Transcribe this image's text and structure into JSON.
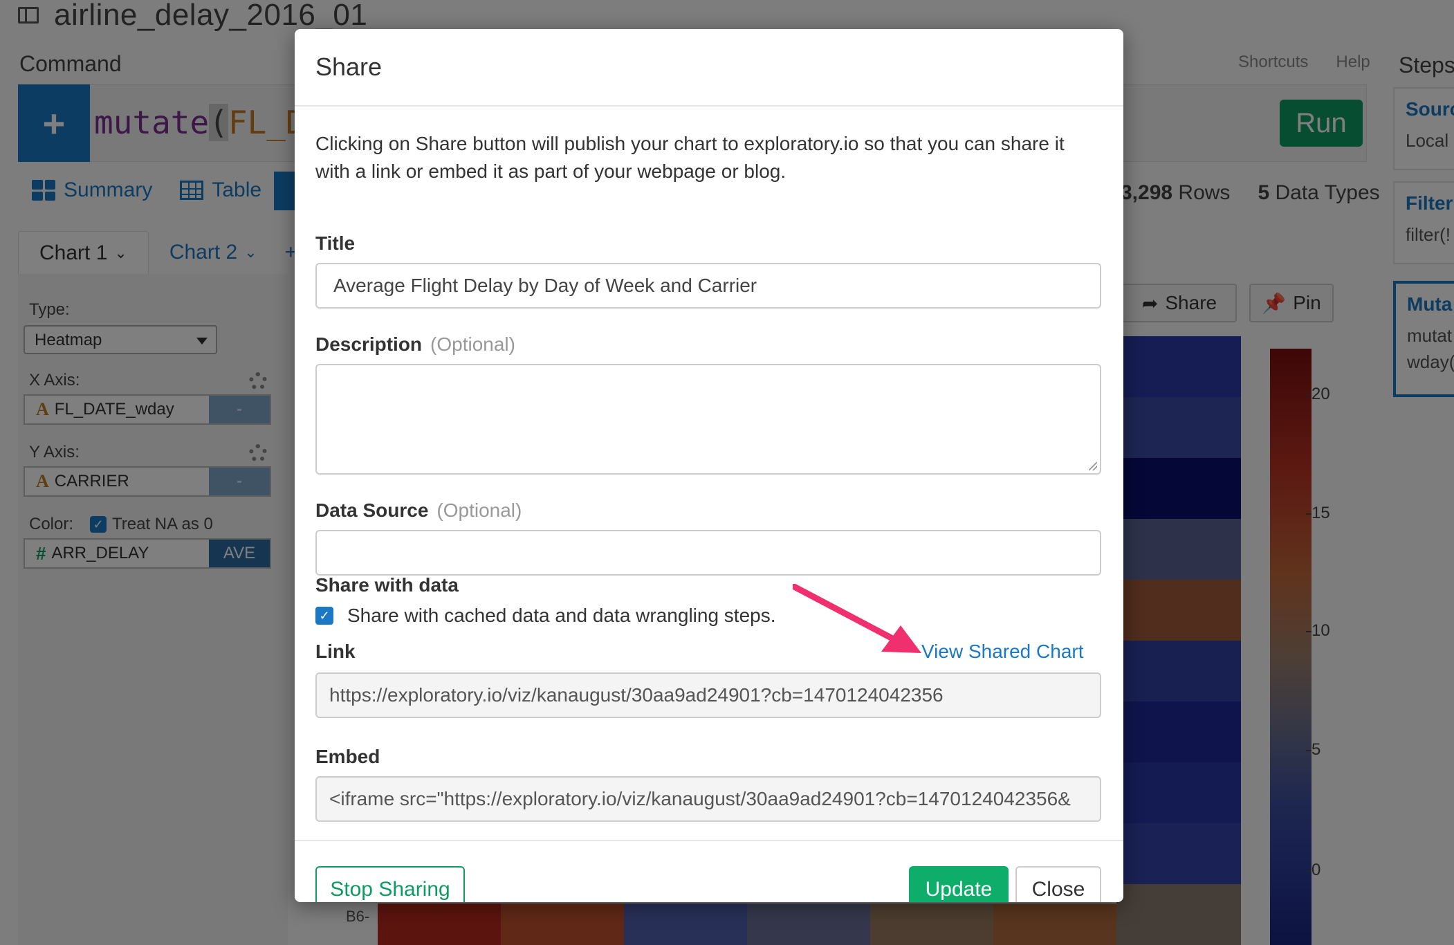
{
  "app": {
    "title": "airline_delay_2016_01",
    "command_label": "Command",
    "shortcuts": "Shortcuts",
    "help": "Help",
    "steps_label": "Steps",
    "command_text": {
      "fn": "mutate",
      "open": "(",
      "arg": "FL_DA"
    },
    "run_label": "Run",
    "view_tabs": [
      "Summary",
      "Table"
    ],
    "stats": {
      "rows_count": "3,298",
      "rows_label": "Rows",
      "types_count": "5",
      "types_label": "Data Types"
    },
    "chart_tabs": [
      "Chart 1",
      "Chart 2"
    ],
    "chart_add": "+",
    "config": {
      "type_label": "Type:",
      "type_value": "Heatmap",
      "x_label": "X Axis:",
      "x_value": "FL_DATE_wday",
      "x_side": "-",
      "y_label": "Y Axis:",
      "y_value": "CARRIER",
      "y_side": "-",
      "color_label": "Color:",
      "treat_na": "Treat NA as 0",
      "color_value": "ARR_DELAY",
      "color_side": "AVE"
    },
    "toolbar": {
      "share": "Share",
      "pin": "Pin"
    },
    "heatmap_bottom_label": "B6-",
    "legend_ticks": [
      "20",
      "15",
      "10",
      "5",
      "0"
    ],
    "steps": [
      {
        "title": "Sourc",
        "body": [
          "Local"
        ]
      },
      {
        "title": "Filter",
        "body": [
          "filter(!"
        ]
      },
      {
        "title": "Muta",
        "body": [
          "mutat",
          "wday("
        ]
      }
    ]
  },
  "modal": {
    "title": "Share",
    "intro": "Clicking on Share button will publish your chart to exploratory.io so that you can share it with a link or embed it as part of your webpage or blog.",
    "title_label": "Title",
    "title_value": "Average Flight Delay by Day of Week and Carrier",
    "description_label": "Description",
    "description_optional": "(Optional)",
    "datasource_label": "Data Source",
    "datasource_optional": "(Optional)",
    "share_data_label": "Share with data",
    "share_data_checkbox": "Share with cached data and data wrangling steps.",
    "link_label": "Link",
    "view_shared_chart": "View Shared Chart",
    "link_value": "https://exploratory.io/viz/kanaugust/30aa9ad24901?cb=1470124042356",
    "embed_label": "Embed",
    "embed_value": "<iframe src=\"https://exploratory.io/viz/kanaugust/30aa9ad24901?cb=1470124042356&",
    "stop_sharing": "Stop Sharing",
    "update": "Update",
    "close": "Close"
  },
  "colors": {
    "accent": "#1b78c4",
    "run_green": "#0e9b62",
    "update_green": "#0eae6a",
    "arrow_pink": "#f0306e"
  }
}
